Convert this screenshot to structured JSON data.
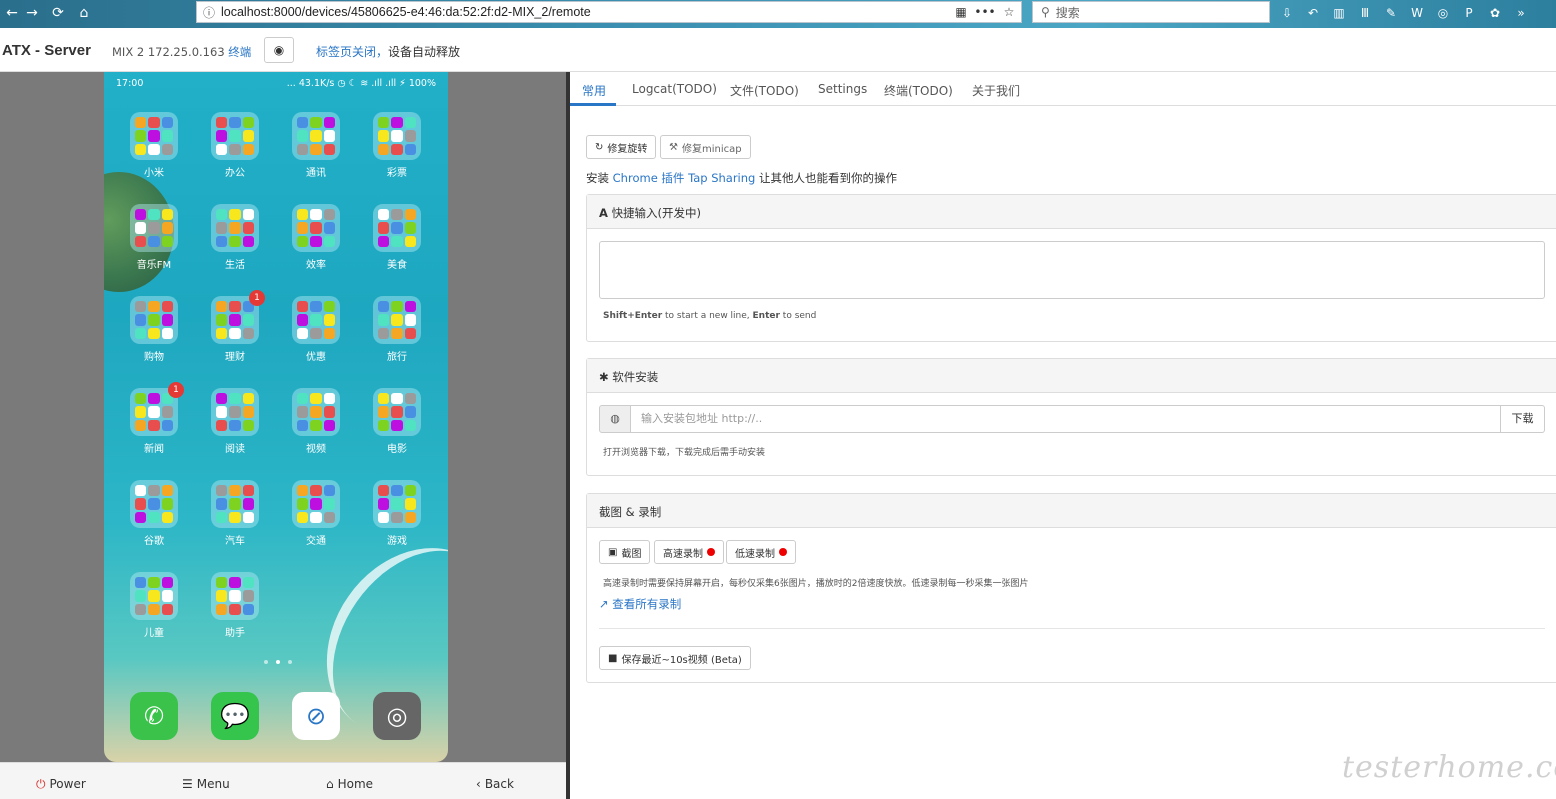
{
  "browser": {
    "back": "←",
    "forward": "→",
    "reload": "⟳",
    "home": "⌂",
    "url": "localhost:8000/devices/45806625-e4:46:da:52:2f:d2-MIX_2/remote",
    "search_placeholder": "搜索"
  },
  "header": {
    "brand": "ATX - Server",
    "device": "MIX 2 172.25.0.163",
    "terminal_link": "终端",
    "notice_blue": "标签页关闭，",
    "notice_rest": "设备自动释放"
  },
  "phone": {
    "time": "17:00",
    "status_right": "... 43.1K/s ◷ ☾ ≋ .ıll .ıll ⚡ 100%",
    "apps": [
      {
        "label": "小米"
      },
      {
        "label": "办公"
      },
      {
        "label": "通讯"
      },
      {
        "label": "彩票"
      },
      {
        "label": "音乐FM"
      },
      {
        "label": "生活"
      },
      {
        "label": "效率"
      },
      {
        "label": "美食"
      },
      {
        "label": "购物"
      },
      {
        "label": "理财",
        "badge": "1"
      },
      {
        "label": "优惠"
      },
      {
        "label": "旅行"
      },
      {
        "label": "新闻",
        "badge": "1"
      },
      {
        "label": "阅读"
      },
      {
        "label": "视频"
      },
      {
        "label": "电影"
      },
      {
        "label": "谷歌"
      },
      {
        "label": "汽车"
      },
      {
        "label": "交通"
      },
      {
        "label": "游戏"
      },
      {
        "label": "儿童"
      },
      {
        "label": "助手"
      }
    ]
  },
  "bottom_bar": {
    "power": "Power",
    "menu": "Menu",
    "home": "Home",
    "back": "Back"
  },
  "tabs": [
    "常用",
    "Logcat(TODO)",
    "文件(TODO)",
    "Settings",
    "终端(TODO)",
    "关于我们"
  ],
  "common": {
    "fix_rotation": "修复旋转",
    "fix_minicap": "修复minicap",
    "install_prefix": "安装",
    "install_link": "Chrome 插件 Tap Sharing",
    "install_suffix": "让其他人也能看到你的操作",
    "quick_input_title": "快捷输入(开发中)",
    "quick_input_hint_1": "Shift+Enter",
    "quick_input_hint_2": " to start a new line, ",
    "quick_input_hint_3": "Enter",
    "quick_input_hint_4": " to send",
    "install_title": "软件安装",
    "install_placeholder": "输入安装包地址 http://..",
    "download_button": "下载",
    "install_hint": "打开浏览器下载，下载完成后需手动安装",
    "screenshot_title": "截图 & 录制",
    "screenshot_button": "截图",
    "fast_record_button": "高速录制",
    "slow_record_button": "低速录制",
    "record_hint": "高速录制时需要保持屏幕开启，每秒仅采集6张图片，播放时的2倍速度快放。低速录制每一秒采集一张图片",
    "view_records_link": "查看所有录制",
    "save_video_button": "保存最近~10s视频 (Beta)"
  },
  "watermark": "testerhome.com",
  "colors": {
    "accent": "#2a76c6",
    "record": "#e00000"
  }
}
